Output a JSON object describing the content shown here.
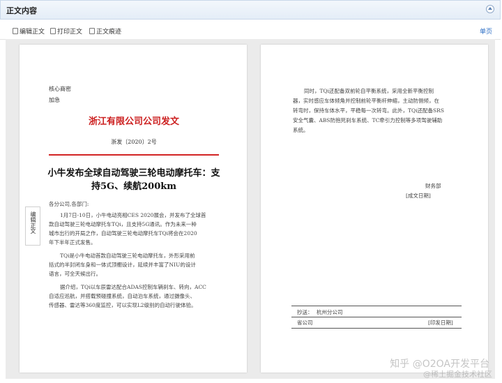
{
  "panel": {
    "title": "正文内容"
  },
  "toolbar": {
    "edit_label": "编辑正文",
    "print_label": "打印正文",
    "draft_label": "正文痕迹",
    "single_page_label": "单页"
  },
  "side_tab": {
    "label": "编辑正文"
  },
  "page1": {
    "secret_level": "核心商密",
    "urgency": "加急",
    "org_title": "浙江有限公司公司发文",
    "doc_number": "浙发〔2020〕2号",
    "headline": "小牛发布全球自动驾驶三轮电动摩托车：支持5G、续航200km",
    "salutation": "各分公司,各部门:",
    "paragraphs": [
      "1月7日-10日，小牛电动亮相CES 2020展会，并发布了全球首",
      "款自动驾驶三轮电动摩托车TQi，且支持5G通讯。作为未来一种",
      "城市出行的开局之作，自动驾驶三轮电动摩托车TQi将会在2020",
      "年下半年正式发售。",
      "TQi是小牛电动首款自动驾驶三轮电动摩托车，外形采用前",
      "括式的半封闭车身和一体式顶棚设计，延续并丰富了NIU的设计",
      "语言，可全天候出行。",
      "据介绍，TQi以车辰雷达配合ADAS控制车辆刹车、转向，ACC",
      "自适应巡航，并搭载预碰撞系统，自动泊车系统，通过摄像头、",
      "传感器、雷达等360度监控，可以实现L2级别的自动行驶体验。"
    ]
  },
  "page2": {
    "paragraphs": [
      "同时，TQi还配备双前轮自平衡系统，采用全新平衡控制",
      "器，实时感应车体倾角并控制前轮平衡杆伸缩，主动防侧倾，在",
      "转弯时，保持车体水平，平稳每一次转弯。此外，TQi还配备SRS",
      "安全气囊、ABS防抱死刹车系统、TC牵引力控制等多项驾驶辅助",
      "系统。"
    ],
    "signer": "财务部",
    "date_placeholder": "[成文日期]",
    "cc_label": "抄送：",
    "cc_value": "杭州分公司",
    "issuer": "省公司",
    "print_date": "[印发日期]"
  },
  "watermark": {
    "main": "知乎 @O2OA开发平台",
    "sub": "@稀土掘金技术社区"
  }
}
